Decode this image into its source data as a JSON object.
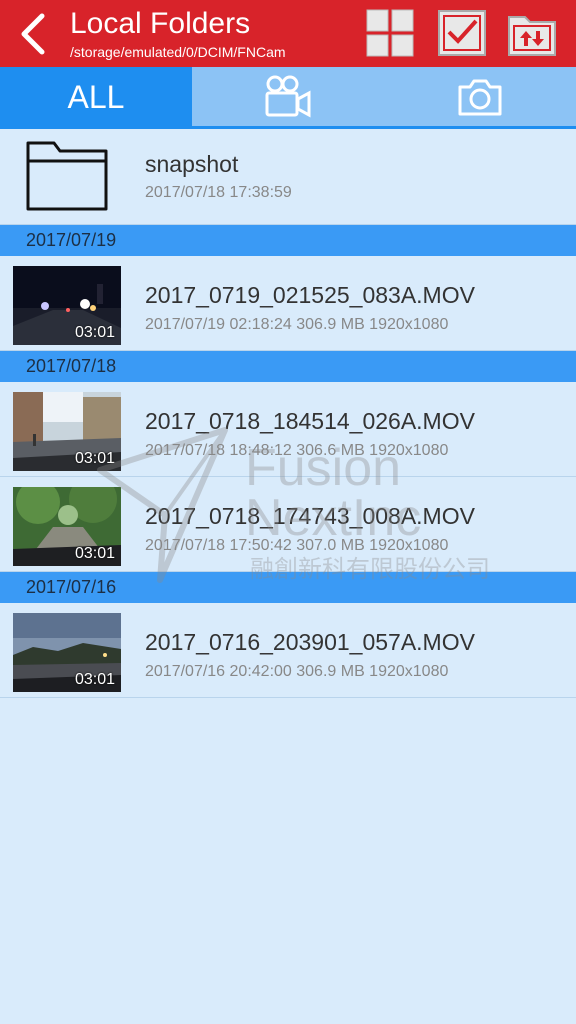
{
  "header": {
    "title": "Local Folders",
    "path": "/storage/emulated/0/DCIM/FNCam",
    "icons": [
      "back-arrow-icon",
      "grid-view-icon",
      "select-checkbox-icon",
      "folder-transfer-icon"
    ]
  },
  "tabs": [
    {
      "label": "ALL",
      "active": true
    },
    {
      "icon": "video-camera-icon",
      "active": false
    },
    {
      "icon": "camera-icon",
      "active": false
    }
  ],
  "folder": {
    "name": "snapshot",
    "date": "2017/07/18 17:38:59"
  },
  "groups": [
    {
      "date": "2017/07/19",
      "items": [
        {
          "name": "2017_0719_021525_083A.MOV",
          "meta": "2017/07/19 02:18:24  306.9 MB  1920x1080",
          "duration": "03:01"
        }
      ]
    },
    {
      "date": "2017/07/18",
      "items": [
        {
          "name": "2017_0718_184514_026A.MOV",
          "meta": "2017/07/18 18:48:12  306.6 MB  1920x1080",
          "duration": "03:01"
        },
        {
          "name": "2017_0718_174743_008A.MOV",
          "meta": "2017/07/18 17:50:42  307.0 MB  1920x1080",
          "duration": "03:01"
        }
      ]
    },
    {
      "date": "2017/07/16",
      "items": [
        {
          "name": "2017_0716_203901_057A.MOV",
          "meta": "2017/07/16 20:42:00  306.9 MB  1920x1080",
          "duration": "03:01"
        }
      ]
    }
  ],
  "watermark": {
    "line1": "Fusion",
    "line2": "NextInc",
    "line3": "融創新科有限股份公司"
  },
  "colors": {
    "header": "#d8232a",
    "tab_active": "#1e8ef0",
    "tab_bar": "#8cc3f5",
    "date_header": "#3a9af5",
    "background": "#d9ebfb"
  }
}
